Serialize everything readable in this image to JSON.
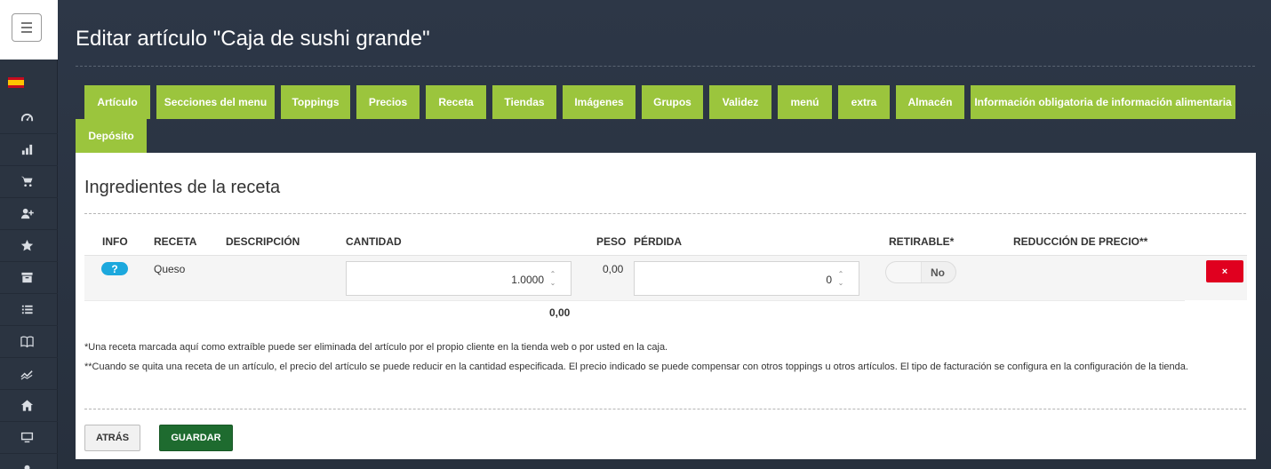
{
  "page": {
    "title": "Editar artículo \"Caja de sushi grande\""
  },
  "sidebar": {
    "flag": "es-flag",
    "items": [
      {
        "icon": "speedometer-icon"
      },
      {
        "icon": "bar-chart-icon"
      },
      {
        "icon": "cart-icon"
      },
      {
        "icon": "add-user-icon"
      },
      {
        "icon": "star-icon"
      },
      {
        "icon": "archive-icon"
      },
      {
        "icon": "list-icon"
      },
      {
        "icon": "book-icon"
      },
      {
        "icon": "trend-icon"
      },
      {
        "icon": "home-icon"
      },
      {
        "icon": "monitor-icon"
      },
      {
        "icon": "person-icon"
      }
    ]
  },
  "tabs": [
    {
      "label": "Artículo"
    },
    {
      "label": "Secciones del menu"
    },
    {
      "label": "Toppings"
    },
    {
      "label": "Precios"
    },
    {
      "label": "Receta"
    },
    {
      "label": "Tiendas"
    },
    {
      "label": "Imágenes"
    },
    {
      "label": "Grupos"
    },
    {
      "label": "Validez"
    },
    {
      "label": "menú"
    },
    {
      "label": "extra"
    },
    {
      "label": "Almacén"
    },
    {
      "label": "Información obligatoria de información alimentaria"
    },
    {
      "label": "Depósito"
    }
  ],
  "recipe": {
    "section_title": "Ingredientes de la receta",
    "columns": {
      "info": "INFO",
      "receta": "RECETA",
      "descripcion": "DESCRIPCIÓN",
      "cantidad": "CANTIDAD",
      "peso": "PESO",
      "perdida": "PÉRDIDA",
      "retirable": "RETIRABLE*",
      "reduccion": "REDUCCIÓN DE PRECIO**"
    },
    "rows": [
      {
        "info_label": "?",
        "receta": "Queso",
        "descripcion": "",
        "cantidad": "1.0000",
        "peso": "0,00",
        "perdida": "0",
        "retirable": "No",
        "delete_label": "×"
      }
    ],
    "total_peso": "0,00",
    "notes": [
      "*Una receta marcada aquí como extraíble puede ser eliminada del artículo por el propio cliente en la tienda web o por usted en la caja.",
      "**Cuando se quita una receta de un artículo, el precio del artículo se puede reducir en la cantidad especificada. El precio indicado se puede compensar con otros toppings u otros artículos. El tipo de facturación se configura en la configuración de la tienda."
    ]
  },
  "actions": {
    "back_label": "ATRÁS",
    "save_label": "GUARDAR"
  },
  "colors": {
    "tab_bg": "#9bc53d",
    "save_bg": "#1e6b2f",
    "delete_bg": "#e0001f",
    "info_bg": "#1ca8dd"
  }
}
